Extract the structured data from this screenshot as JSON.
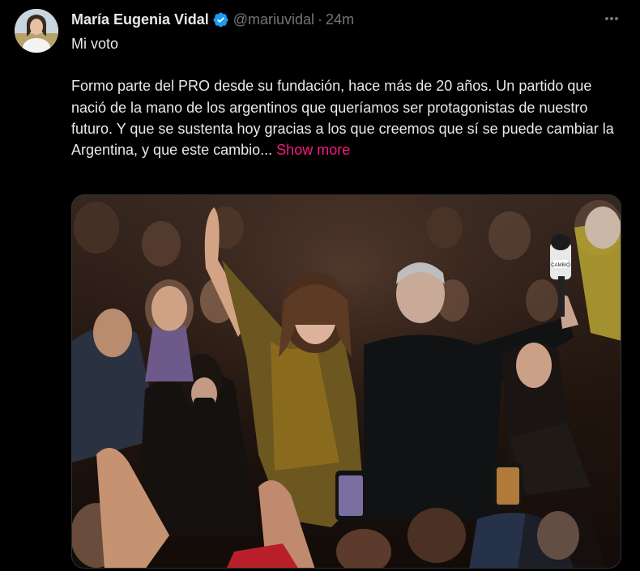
{
  "author": {
    "display_name": "María Eugenia Vidal",
    "handle": "@mariuvidal",
    "separator": "·",
    "timestamp": "24m",
    "verified": true,
    "verified_color": "#1d9bf0"
  },
  "tweet": {
    "title_line": "Mi voto",
    "body": "Formo parte del PRO desde su fundación, hace más de 20 años. Un partido que nació de la mano de los argentinos que queríamos ser protagonistas de nuestro futuro. Y que se sustenta hoy gracias a los que creemos que sí se puede cambiar la Argentina, y que este cambio...",
    "show_more": "Show more"
  },
  "media": {
    "microphone_label": "CAMBIO"
  },
  "icons": {
    "verified": "verified-badge-icon",
    "more": "more-options-icon"
  },
  "colors": {
    "background": "#000000",
    "text": "#e7e9ea",
    "secondary_text": "#71767b",
    "link": "#f91880",
    "accent": "#1d9bf0"
  }
}
